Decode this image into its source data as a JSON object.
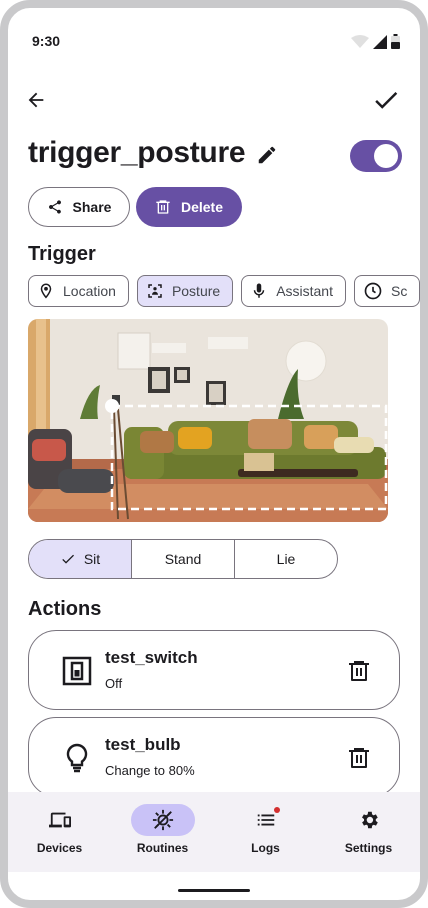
{
  "status_bar": {
    "time": "9:30"
  },
  "app_bar": {
    "back_icon": "arrow-back-icon",
    "confirm_icon": "check-icon"
  },
  "routine": {
    "name": "trigger_posture",
    "enabled": true
  },
  "buttons": {
    "share_label": "Share",
    "delete_label": "Delete"
  },
  "trigger": {
    "title": "Trigger",
    "chips": [
      {
        "label": "Location",
        "icon": "location-pin-icon",
        "selected": false
      },
      {
        "label": "Posture",
        "icon": "posture-scan-icon",
        "selected": true
      },
      {
        "label": "Assistant",
        "icon": "microphone-icon",
        "selected": false
      },
      {
        "label": "Sc",
        "icon": "clock-icon",
        "selected": false
      }
    ],
    "postures": [
      {
        "label": "Sit",
        "selected": true
      },
      {
        "label": "Stand",
        "selected": false
      },
      {
        "label": "Lie",
        "selected": false
      }
    ]
  },
  "actions": {
    "title": "Actions",
    "items": [
      {
        "name": "test_switch",
        "status": "Off",
        "icon": "switch-icon"
      },
      {
        "name": "test_bulb",
        "status": "Change to 80%",
        "icon": "bulb-icon"
      }
    ]
  },
  "bottom_nav": [
    {
      "label": "Devices",
      "icon": "devices-icon",
      "active": false
    },
    {
      "label": "Routines",
      "icon": "routines-icon",
      "active": true
    },
    {
      "label": "Logs",
      "icon": "logs-icon",
      "active": false,
      "badge": true
    },
    {
      "label": "Settings",
      "icon": "gear-icon",
      "active": false
    }
  ],
  "colors": {
    "primary": "#6750a4",
    "selected_container": "#e3e0f9",
    "nav_indicator": "#c9c2f7",
    "badge": "#d32f2f"
  }
}
